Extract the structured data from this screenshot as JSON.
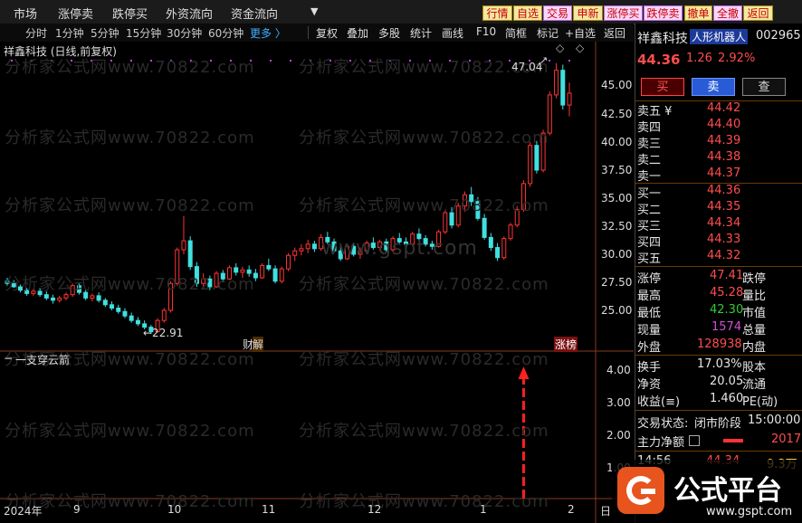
{
  "top_menu": [
    "市场",
    "涨停卖",
    "跌停买",
    "外资流向",
    "资金流向"
  ],
  "top_dropdown_icon": "caret-down-icon",
  "top_buttons": [
    "行情",
    "自选",
    "交易",
    "申新",
    "涨停买",
    "跌停卖",
    "撤单",
    "全撤",
    "返回"
  ],
  "toolbar": {
    "periods": [
      "分时",
      "1分钟",
      "5分钟",
      "15分钟",
      "30分钟",
      "60分钟"
    ],
    "more": "更多 〉",
    "actions": [
      "复权",
      "叠加",
      "多股",
      "统计",
      "画线",
      "F10",
      "简框",
      "标记",
      "+自选",
      "返回"
    ]
  },
  "chart": {
    "title": "祥鑫科技 (日线,前复权)",
    "high_label": "47.04",
    "low_label": "←22.91",
    "badge_left": "财",
    "badge_left2": "解",
    "badge_right": "涨榜",
    "indicator_title": "一支穿云箭",
    "y_ticks_price": [
      "45.00",
      "42.50",
      "40.00",
      "37.50",
      "35.00",
      "32.50",
      "30.00",
      "27.50",
      "25.00"
    ],
    "y_ticks_ind": [
      "4.00",
      "3.00",
      "2.00",
      "1.00"
    ],
    "x_labels": [
      "2024年",
      "9",
      "10",
      "11",
      "12",
      "1",
      "2"
    ],
    "x_right": "日",
    "watermark": "分析家公式网www.70822.com",
    "watermark_center": "www.gspt.com",
    "colors": {
      "up": "#ff3333",
      "down": "#3fe0e0",
      "arrow": "#ff2020",
      "dots": "#c040ff"
    }
  },
  "chart_data": {
    "type": "candlestick",
    "title": "祥鑫科技 (日线,前复权)",
    "ylim": [
      22,
      48
    ],
    "annotations": {
      "high": 47.04,
      "low": 22.91
    },
    "candles": [
      [
        27.6,
        27.9,
        27.2,
        27.4
      ],
      [
        27.4,
        27.7,
        27.0,
        27.1
      ],
      [
        27.1,
        27.3,
        26.6,
        26.8
      ],
      [
        26.8,
        27.0,
        26.3,
        26.5
      ],
      [
        26.5,
        26.9,
        26.3,
        26.7
      ],
      [
        26.7,
        27.0,
        26.2,
        26.4
      ],
      [
        26.4,
        26.7,
        25.9,
        26.1
      ],
      [
        26.1,
        26.4,
        25.6,
        25.9
      ],
      [
        25.9,
        26.3,
        25.7,
        26.1
      ],
      [
        26.1,
        26.6,
        25.9,
        26.4
      ],
      [
        26.4,
        27.4,
        26.2,
        27.2
      ],
      [
        27.2,
        27.5,
        26.4,
        26.6
      ],
      [
        26.6,
        26.9,
        25.9,
        26.1
      ],
      [
        26.1,
        26.5,
        25.8,
        26.3
      ],
      [
        26.3,
        26.6,
        25.7,
        25.9
      ],
      [
        25.9,
        26.1,
        25.3,
        25.5
      ],
      [
        25.5,
        25.8,
        25.0,
        25.2
      ],
      [
        25.2,
        25.5,
        24.7,
        24.9
      ],
      [
        24.9,
        25.2,
        24.3,
        24.5
      ],
      [
        24.5,
        24.8,
        23.9,
        24.1
      ],
      [
        24.1,
        24.4,
        23.6,
        23.8
      ],
      [
        23.8,
        24.1,
        23.3,
        23.5
      ],
      [
        23.5,
        23.7,
        22.91,
        23.1
      ],
      [
        23.1,
        24.3,
        23.0,
        24.1
      ],
      [
        24.1,
        25.2,
        23.9,
        25.0
      ],
      [
        25.0,
        27.6,
        24.8,
        27.4
      ],
      [
        27.4,
        30.6,
        27.2,
        30.4
      ],
      [
        30.4,
        33.4,
        30.0,
        31.2
      ],
      [
        31.2,
        31.6,
        28.6,
        28.9
      ],
      [
        28.9,
        29.3,
        27.1,
        27.4
      ],
      [
        27.4,
        28.3,
        26.9,
        27.8
      ],
      [
        27.8,
        28.1,
        26.8,
        27.1
      ],
      [
        27.1,
        28.5,
        27.0,
        28.3
      ],
      [
        28.3,
        28.6,
        27.5,
        27.8
      ],
      [
        27.8,
        29.0,
        27.7,
        28.8
      ],
      [
        28.8,
        29.2,
        28.1,
        28.4
      ],
      [
        28.4,
        28.9,
        27.9,
        28.6
      ],
      [
        28.6,
        29.0,
        28.0,
        28.3
      ],
      [
        28.3,
        28.7,
        27.6,
        27.9
      ],
      [
        27.9,
        29.2,
        27.8,
        29.0
      ],
      [
        29.0,
        29.6,
        28.5,
        28.7
      ],
      [
        28.7,
        29.0,
        27.4,
        27.6
      ],
      [
        27.6,
        28.9,
        27.4,
        28.7
      ],
      [
        28.7,
        30.1,
        28.5,
        29.9
      ],
      [
        29.9,
        30.6,
        29.4,
        30.3
      ],
      [
        30.3,
        30.9,
        29.9,
        30.5
      ],
      [
        30.5,
        31.3,
        30.1,
        30.9
      ],
      [
        30.9,
        31.2,
        30.2,
        30.5
      ],
      [
        30.5,
        31.8,
        30.3,
        31.5
      ],
      [
        31.5,
        32.0,
        30.9,
        31.1
      ],
      [
        31.1,
        31.4,
        30.1,
        30.3
      ],
      [
        30.3,
        30.8,
        29.4,
        29.6
      ],
      [
        29.6,
        30.9,
        29.5,
        30.7
      ],
      [
        30.7,
        31.0,
        29.8,
        30.0
      ],
      [
        30.0,
        30.6,
        29.6,
        30.3
      ],
      [
        30.3,
        31.2,
        30.1,
        31.0
      ],
      [
        31.0,
        31.5,
        30.4,
        30.6
      ],
      [
        30.6,
        31.3,
        30.3,
        31.1
      ],
      [
        31.1,
        31.4,
        30.2,
        30.4
      ],
      [
        30.4,
        31.6,
        30.2,
        31.4
      ],
      [
        31.4,
        31.9,
        30.9,
        31.1
      ],
      [
        31.1,
        31.5,
        30.6,
        30.9
      ],
      [
        30.9,
        32.0,
        30.7,
        31.8
      ],
      [
        31.8,
        32.3,
        31.2,
        31.4
      ],
      [
        31.4,
        31.7,
        30.7,
        30.9
      ],
      [
        30.9,
        31.2,
        30.4,
        30.7
      ],
      [
        30.7,
        32.2,
        30.6,
        32.0
      ],
      [
        32.0,
        33.9,
        31.8,
        33.7
      ],
      [
        33.7,
        34.2,
        32.3,
        32.6
      ],
      [
        32.6,
        34.6,
        32.4,
        34.3
      ],
      [
        34.3,
        35.6,
        33.8,
        35.3
      ],
      [
        35.3,
        36.0,
        34.3,
        34.7
      ],
      [
        34.7,
        35.1,
        33.0,
        33.2
      ],
      [
        33.2,
        33.6,
        31.3,
        31.5
      ],
      [
        31.5,
        31.9,
        30.3,
        30.6
      ],
      [
        30.6,
        31.0,
        29.4,
        29.7
      ],
      [
        29.7,
        31.6,
        29.5,
        31.4
      ],
      [
        31.4,
        32.8,
        31.2,
        32.6
      ],
      [
        32.6,
        34.3,
        32.4,
        34.0
      ],
      [
        34.0,
        36.6,
        33.8,
        36.3
      ],
      [
        36.3,
        40.0,
        36.0,
        39.7
      ],
      [
        39.7,
        40.1,
        37.2,
        37.5
      ],
      [
        37.5,
        41.1,
        37.3,
        40.8
      ],
      [
        40.8,
        44.5,
        40.6,
        44.2
      ],
      [
        44.2,
        47.04,
        43.9,
        46.4
      ],
      [
        46.4,
        46.9,
        42.9,
        43.3
      ],
      [
        43.3,
        45.3,
        42.3,
        44.36
      ]
    ],
    "indicator": {
      "name": "一支穿云箭",
      "ylim": [
        0,
        4.6
      ],
      "signal_value": 4.0
    }
  },
  "right_panel": {
    "stock_name": "祥鑫科技",
    "concept": "人形机器人",
    "code": "002965",
    "price": "44.36",
    "change": "1.26",
    "change_pct": "2.92%",
    "buttons": [
      "买",
      "卖",
      "查"
    ],
    "asks": [
      {
        "label": "卖五 ¥",
        "price": "44.42"
      },
      {
        "label": "卖四",
        "price": "44.40"
      },
      {
        "label": "卖三",
        "price": "44.39"
      },
      {
        "label": "卖二",
        "price": "44.38"
      },
      {
        "label": "卖一",
        "price": "44.37"
      }
    ],
    "bids": [
      {
        "label": "买一",
        "price": "44.36"
      },
      {
        "label": "买二",
        "price": "44.35"
      },
      {
        "label": "买三",
        "price": "44.34"
      },
      {
        "label": "买四",
        "price": "44.33"
      },
      {
        "label": "买五",
        "price": "44.32"
      }
    ],
    "stats": [
      {
        "k1": "涨停",
        "v1": "47.41",
        "k2": "跌停"
      },
      {
        "k1": "最高",
        "v1": "45.28",
        "k2": "量比"
      },
      {
        "k1": "最低",
        "v1": "42.30",
        "k2": "市值"
      },
      {
        "k1": "现量",
        "v1": "1574",
        "k2": "总量"
      },
      {
        "k1": "外盘",
        "v1": "128938",
        "k2": "内盘"
      }
    ],
    "stats2": [
      {
        "k1": "换手",
        "v1": "17.03%",
        "k2": "股本"
      },
      {
        "k1": "净资",
        "v1": "20.05",
        "k2": "流通"
      },
      {
        "k1": "收益(≡)",
        "v1": "1.460",
        "k2": "PE(动)"
      }
    ],
    "trade_status_label": "交易状态:",
    "trade_status": "闭市阶段",
    "trade_time": "15:00:00",
    "net_label": "主力净额",
    "net_value": "2017",
    "tick_time": "14:56",
    "tick_price": "44.34",
    "tick_vol": "9.3万"
  },
  "logo": {
    "text": "公式平台",
    "url_text": "www.gspt.com"
  }
}
